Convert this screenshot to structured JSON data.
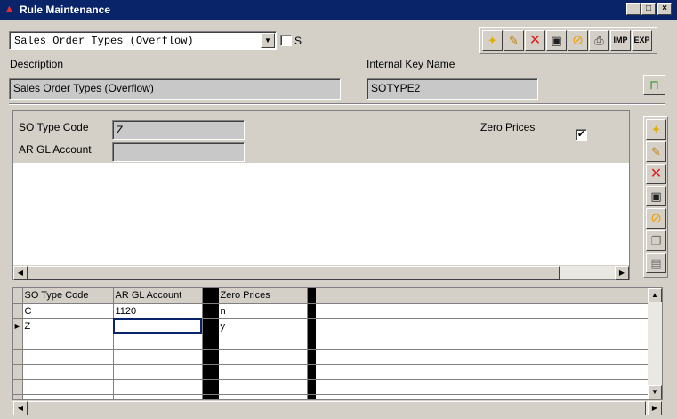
{
  "window": {
    "title": "Rule Maintenance",
    "minimize": "_",
    "maximize": "□",
    "close": "×"
  },
  "header": {
    "rule_select_value": "Sales Order Types (Overflow)",
    "s_checkbox_label": "S",
    "description_label": "Description",
    "description_value": "Sales Order Types (Overflow)",
    "internal_key_label": "Internal Key Name",
    "internal_key_value": "SOTYPE2"
  },
  "toolbar": {
    "import_label": "IMP",
    "export_label": "EXP"
  },
  "detail": {
    "so_type_code_label": "SO Type Code",
    "so_type_code_value": "Z",
    "ar_gl_account_label": "AR GL Account",
    "ar_gl_account_value": "",
    "zero_prices_label": "Zero Prices",
    "zero_prices_checked": "✔"
  },
  "grid": {
    "columns": [
      "SO Type Code",
      "AR GL Account",
      "",
      "Zero Prices",
      "",
      ""
    ],
    "rows": [
      {
        "indicator": "",
        "cells": [
          "C",
          "1120",
          "",
          "n",
          "",
          ""
        ]
      },
      {
        "indicator": "▶",
        "cells": [
          "Z",
          "",
          "",
          "y",
          "",
          ""
        ]
      }
    ],
    "empty_rows": 5
  },
  "icons": {
    "scroll_left": "◀",
    "scroll_right": "▶",
    "scroll_up": "▲",
    "scroll_down": "▼",
    "dropdown": "▼"
  }
}
